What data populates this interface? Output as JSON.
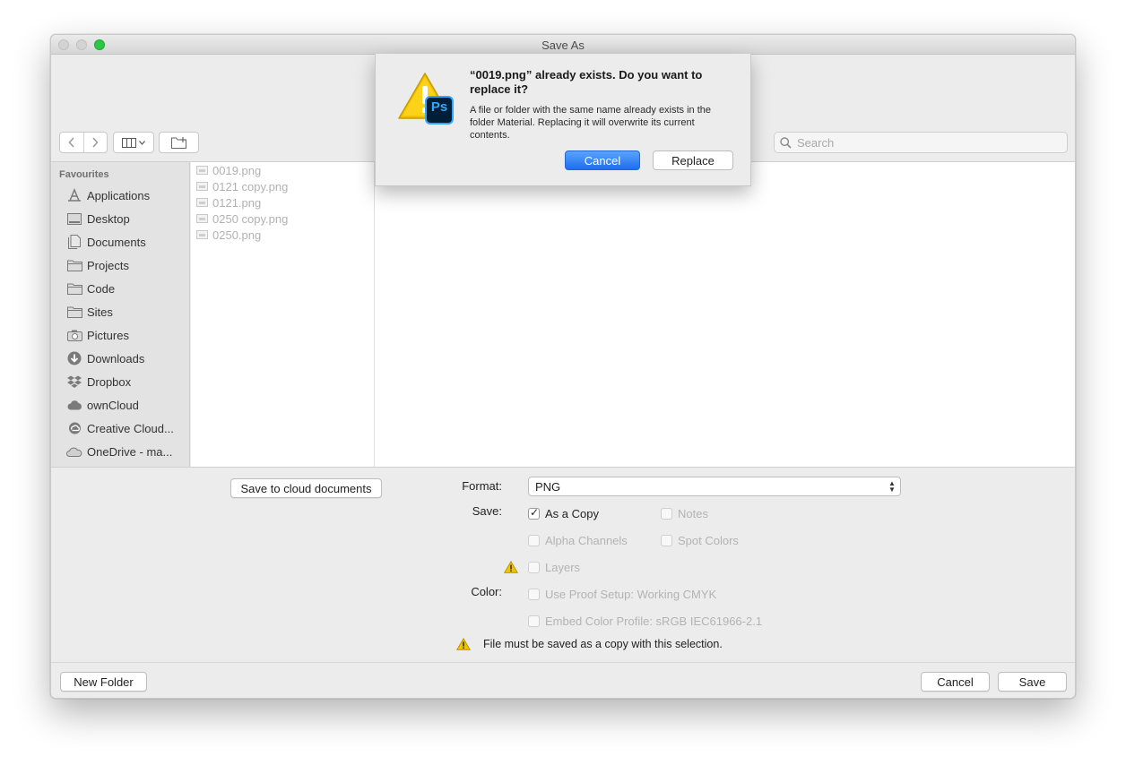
{
  "window": {
    "title": "Save As"
  },
  "toolbar": {
    "back_icon": "chevron-left-icon",
    "forward_icon": "chevron-right-icon",
    "view_icon": "column-view-icon",
    "new_folder_icon": "new-folder-icon",
    "search_placeholder": "Search"
  },
  "sidebar": {
    "heading": "Favourites",
    "items": [
      {
        "label": "Applications",
        "icon": "applications-icon"
      },
      {
        "label": "Desktop",
        "icon": "desktop-icon"
      },
      {
        "label": "Documents",
        "icon": "documents-icon"
      },
      {
        "label": "Projects",
        "icon": "folder-icon"
      },
      {
        "label": "Code",
        "icon": "folder-icon"
      },
      {
        "label": "Sites",
        "icon": "folder-icon"
      },
      {
        "label": "Pictures",
        "icon": "camera-icon"
      },
      {
        "label": "Downloads",
        "icon": "download-icon"
      },
      {
        "label": "Dropbox",
        "icon": "dropbox-icon"
      },
      {
        "label": "ownCloud",
        "icon": "cloud-icon"
      },
      {
        "label": "Creative Cloud...",
        "icon": "creative-cloud-icon"
      },
      {
        "label": "OneDrive - ma...",
        "icon": "onedrive-icon"
      }
    ]
  },
  "files": [
    "0019.png",
    "0121 copy.png",
    "0121.png",
    "0250 copy.png",
    "0250.png"
  ],
  "options": {
    "cloud_button": "Save to cloud documents",
    "format_label": "Format:",
    "format_value": "PNG",
    "save_label": "Save:",
    "color_label": "Color:",
    "checkboxes": {
      "as_a_copy": {
        "label": "As a Copy",
        "checked": true
      },
      "notes": {
        "label": "Notes",
        "checked": false
      },
      "alpha_channels": {
        "label": "Alpha Channels",
        "checked": false
      },
      "spot_colors": {
        "label": "Spot Colors",
        "checked": false
      },
      "layers": {
        "label": "Layers",
        "checked": false
      },
      "use_proof_setup": {
        "label": "Use Proof Setup:  Working CMYK",
        "checked": false
      },
      "embed_color_profile": {
        "label": "Embed Color Profile:  sRGB IEC61966-2.1",
        "checked": false
      }
    },
    "warning_text": "File must be saved as a copy with this selection."
  },
  "bottom": {
    "new_folder": "New Folder",
    "cancel": "Cancel",
    "save": "Save"
  },
  "alert": {
    "title": "“0019.png” already exists. Do you want to replace it?",
    "message": "A file or folder with the same name already exists in the folder Material. Replacing it will overwrite its current contents.",
    "cancel": "Cancel",
    "replace": "Replace",
    "badge_text": "Ps",
    "colors": {
      "accent": "#1c6ff0",
      "warning": "#f2c200",
      "photoshop": "#31a8ff"
    }
  }
}
